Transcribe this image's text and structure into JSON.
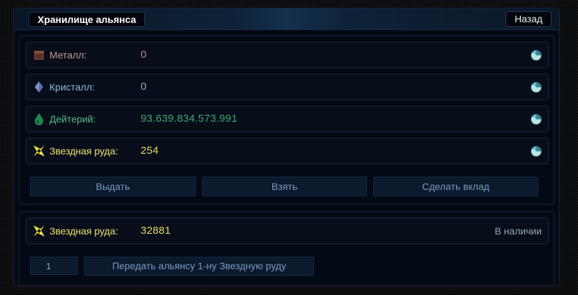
{
  "header": {
    "title": "Хранилище альянса",
    "back_label": "Назад"
  },
  "resources": [
    {
      "icon": "metal-icon",
      "label": "Металл:",
      "value": "0"
    },
    {
      "icon": "crystal-icon",
      "label": "Кристалл:",
      "value": "0"
    },
    {
      "icon": "deuterium-icon",
      "label": "Дейтерий:",
      "value": "93.639.834.573.991"
    },
    {
      "icon": "star-ore-icon",
      "label": "Звездная руда:",
      "value": "254"
    }
  ],
  "actions": {
    "give": "Выдать",
    "take": "Взять",
    "deposit": "Сделать вклад"
  },
  "star_ore": {
    "label": "Звездная руда:",
    "value": "32881",
    "status": "В наличии"
  },
  "transfer": {
    "quantity": "1",
    "button": "Передать альянсу 1-ну Звездную руду"
  },
  "colors": {
    "metal": "#d37f77",
    "crystal": "#7ab5d8",
    "deuterium": "#3fa675",
    "star_ore": "#e8db5a",
    "button_text": "#7a9bc0",
    "panel_bg": "#050b16"
  }
}
